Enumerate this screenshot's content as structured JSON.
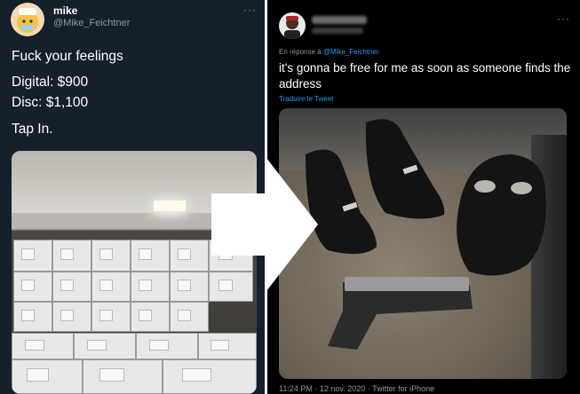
{
  "left_tweet": {
    "name": "mike",
    "handle": "@Mike_Feichtner",
    "more": "···",
    "lines": [
      "Fuck your feelings",
      "Digital: $900",
      "Disc: $1,100",
      "Tap In."
    ]
  },
  "right_tweet": {
    "more": "···",
    "reply_prefix": "En réponse à ",
    "reply_handle": "@Mike_Feichtner",
    "text": "it's gonna be free for me as soon as someone finds the address",
    "translate": "Traduire le Tweet",
    "meta": "11:24 PM · 12 nov. 2020 · Twitter for iPhone"
  },
  "colors": {
    "link": "#1da1f2",
    "left_bg": "#15202b",
    "right_bg": "#000000",
    "muted": "#8899a6"
  }
}
